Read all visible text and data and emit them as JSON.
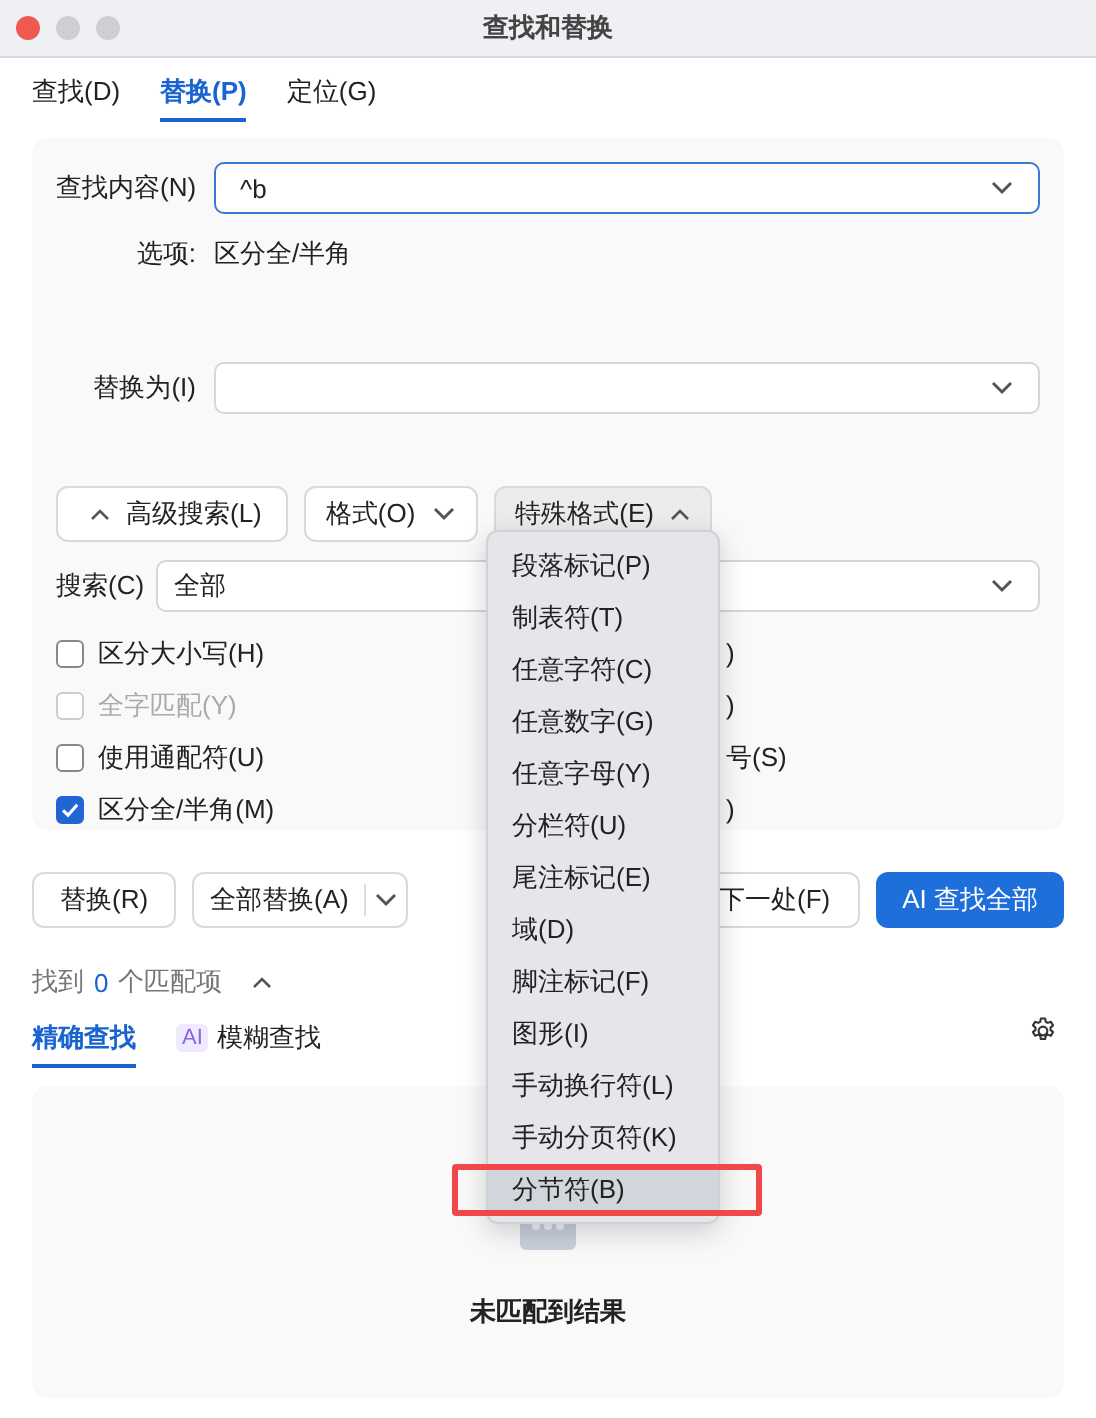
{
  "window": {
    "title": "查找和替换"
  },
  "tabs": [
    {
      "label": "查找(D)",
      "selected": false
    },
    {
      "label": "替换(P)",
      "selected": true
    },
    {
      "label": "定位(G)",
      "selected": false
    }
  ],
  "find": {
    "label": "查找内容(N)",
    "value": "^b"
  },
  "options": {
    "label": "选项:",
    "value": "区分全/半角"
  },
  "replace": {
    "label": "替换为(I)"
  },
  "toolbar": [
    {
      "label": "高级搜索(L)",
      "kind": "collapse"
    },
    {
      "label": "格式(O)",
      "kind": "dropdown"
    },
    {
      "label": "特殊格式(E)",
      "kind": "open"
    }
  ],
  "search": {
    "label": "搜索(C)",
    "value": "全部"
  },
  "checkboxes": [
    {
      "label": "区分大小写(H)",
      "checked": false,
      "disabled": false
    },
    {
      "label": "全字匹配(Y)",
      "checked": false,
      "disabled": true
    },
    {
      "label": "使用通配符(U)",
      "checked": false,
      "disabled": false
    },
    {
      "label": "区分全/半角(M)",
      "checked": true,
      "disabled": false
    }
  ],
  "checkboxes_right": [
    {
      "label": ")"
    },
    {
      "label": ")"
    },
    {
      "label": "号(S)"
    },
    {
      "label": ")"
    }
  ],
  "actions": [
    {
      "label": "替换(R)",
      "kind": "plain"
    },
    {
      "label": "全部替换(A)",
      "kind": "split"
    },
    {
      "label": "下一处(F)",
      "kind": "plain"
    },
    {
      "label": "AI 查找全部",
      "kind": "primary"
    }
  ],
  "status": {
    "prefix": "找到",
    "count": "0",
    "suffix": "个匹配项"
  },
  "result_tabs": [
    {
      "label": "精确查找",
      "selected": true
    },
    {
      "label": "模糊查找",
      "selected": false,
      "badge": "AI"
    }
  ],
  "results": {
    "empty_text": "未匹配到结果"
  },
  "special_menu": {
    "items": [
      {
        "label": "段落标记(P)",
        "highlighted": false
      },
      {
        "label": "制表符(T)",
        "highlighted": false
      },
      {
        "label": "任意字符(C)",
        "highlighted": false
      },
      {
        "label": "任意数字(G)",
        "highlighted": false
      },
      {
        "label": "任意字母(Y)",
        "highlighted": false
      },
      {
        "label": "分栏符(U)",
        "highlighted": false
      },
      {
        "label": "尾注标记(E)",
        "highlighted": false
      },
      {
        "label": "域(D)",
        "highlighted": false
      },
      {
        "label": "脚注标记(F)",
        "highlighted": false
      },
      {
        "label": "图形(I)",
        "highlighted": false
      },
      {
        "label": "手动换行符(L)",
        "highlighted": false
      },
      {
        "label": "手动分页符(K)",
        "highlighted": false
      },
      {
        "label": "分节符(B)",
        "highlighted": true
      }
    ]
  }
}
